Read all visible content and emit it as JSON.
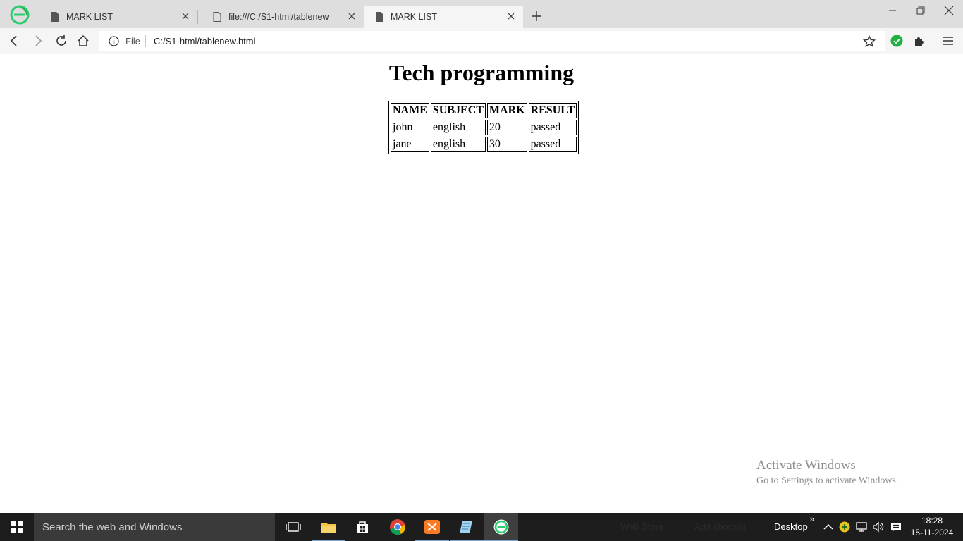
{
  "tabs": [
    {
      "title": "MARK LIST"
    },
    {
      "title": "file:///C:/S1-html/tablenew"
    },
    {
      "title": "MARK LIST"
    }
  ],
  "omnibox": {
    "scheme_label": "File",
    "url": "C:/S1-html/tablenew.html"
  },
  "page": {
    "heading": "Tech programming",
    "table": {
      "headers": [
        "NAME",
        "SUBJECT",
        "MARK",
        "RESULT"
      ],
      "rows": [
        [
          "john",
          "english",
          "20",
          "passed"
        ],
        [
          "jane",
          "english",
          "30",
          "passed"
        ]
      ]
    }
  },
  "watermark": {
    "line1": "Activate Windows",
    "line2": "Go to Settings to activate Windows."
  },
  "taskbar": {
    "search_placeholder": "Search the web and Windows",
    "toolbar_items": [
      "Web Store",
      "Add shortcut"
    ],
    "desktop_label": "Desktop",
    "expand_glyph": "»",
    "time": "18:28",
    "date": "15-11-2024"
  },
  "icons": {
    "browser_logo": "edge-style-e-icon",
    "extension_check": "green-check-icon"
  },
  "colors": {
    "brand_green": "#2ecc71",
    "check_green": "#1fb141",
    "taskbar": "#1d1d1d"
  }
}
